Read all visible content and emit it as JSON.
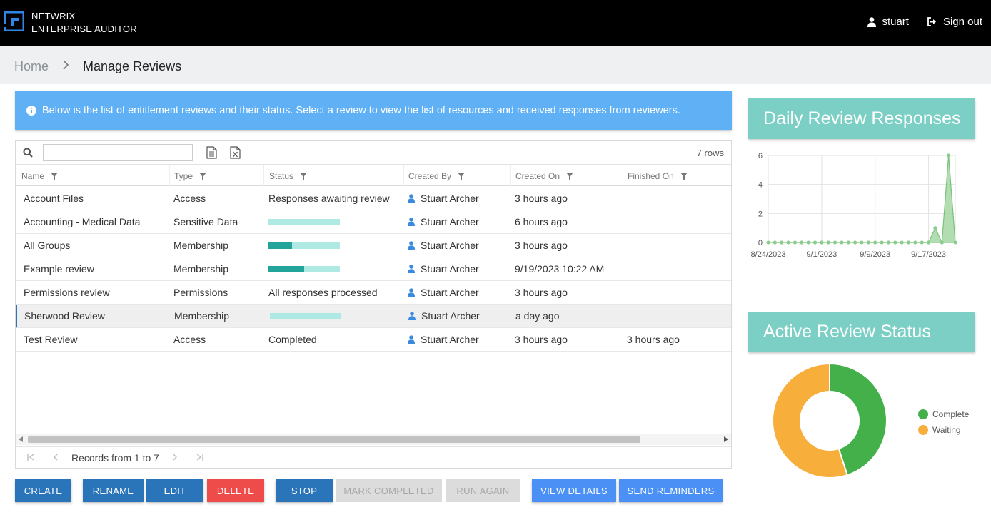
{
  "app": {
    "brand_line1": "NETWRIX",
    "brand_line2": "ENTERPRISE AUDITOR",
    "user": "stuart",
    "signout": "Sign out"
  },
  "breadcrumb": {
    "home": "Home",
    "current": "Manage Reviews"
  },
  "info": "Below is the list of entitlement reviews and their status. Select a review to view the list of resources and received responses from reviewers.",
  "grid": {
    "search_value": "",
    "row_count": "7 rows",
    "columns": [
      "Name",
      "Type",
      "Status",
      "Created By",
      "Created On",
      "Finished On"
    ],
    "rows": [
      {
        "name": "Account Files",
        "type": "Access",
        "status": "Responses awaiting review",
        "progress": null,
        "created_by": "Stuart Archer",
        "created_on": "3 hours ago",
        "finished_on": ""
      },
      {
        "name": "Accounting - Medical Data",
        "type": "Sensitive Data",
        "status": "",
        "progress": 0,
        "created_by": "Stuart Archer",
        "created_on": "6 hours ago",
        "finished_on": ""
      },
      {
        "name": "All Groups",
        "type": "Membership",
        "status": "",
        "progress": 0.33,
        "created_by": "Stuart Archer",
        "created_on": "3 hours ago",
        "finished_on": ""
      },
      {
        "name": "Example review",
        "type": "Membership",
        "status": "",
        "progress": 0.5,
        "created_by": "Stuart Archer",
        "created_on": "9/19/2023 10:22 AM",
        "finished_on": ""
      },
      {
        "name": "Permissions review",
        "type": "Permissions",
        "status": "All responses processed",
        "progress": null,
        "created_by": "Stuart Archer",
        "created_on": "3 hours ago",
        "finished_on": ""
      },
      {
        "name": "Sherwood Review",
        "type": "Membership",
        "status": "",
        "progress": 0,
        "created_by": "Stuart Archer",
        "created_on": "a day ago",
        "finished_on": ""
      },
      {
        "name": "Test Review",
        "type": "Access",
        "status": "Completed",
        "progress": null,
        "created_by": "Stuart Archer",
        "created_on": "3 hours ago",
        "finished_on": "3 hours ago"
      }
    ],
    "selected_row": 5,
    "pager_label": "Records from 1 to 7"
  },
  "buttons": {
    "create": "CREATE",
    "rename": "RENAME",
    "edit": "EDIT",
    "delete": "DELETE",
    "stop": "STOP",
    "mark_completed": "MARK COMPLETED",
    "run_again": "RUN AGAIN",
    "view_details": "VIEW DETAILS",
    "send_reminders": "SEND REMINDERS"
  },
  "panels": {
    "daily_title": "Daily Review Responses",
    "status_title": "Active Review Status"
  },
  "colors": {
    "accent": "#2a74b9",
    "info": "#5fb0f5",
    "panel": "#7bcfc4",
    "complete": "#43b04a",
    "waiting": "#f7ae3b"
  },
  "chart_data": [
    {
      "type": "area",
      "title": "Daily Review Responses",
      "x_tick_labels": [
        "8/24/2023",
        "9/1/2023",
        "9/9/2023",
        "9/17/2023"
      ],
      "y_tick_labels": [
        "0",
        "2",
        "4",
        "6"
      ],
      "ylim": [
        0,
        6
      ],
      "x": [
        "8/24/2023",
        "8/25/2023",
        "8/26/2023",
        "8/27/2023",
        "8/28/2023",
        "8/29/2023",
        "8/30/2023",
        "8/31/2023",
        "9/1/2023",
        "9/2/2023",
        "9/3/2023",
        "9/4/2023",
        "9/5/2023",
        "9/6/2023",
        "9/7/2023",
        "9/8/2023",
        "9/9/2023",
        "9/10/2023",
        "9/11/2023",
        "9/12/2023",
        "9/13/2023",
        "9/14/2023",
        "9/15/2023",
        "9/16/2023",
        "9/17/2023",
        "9/18/2023",
        "9/19/2023",
        "9/20/2023",
        "9/21/2023"
      ],
      "values": [
        0,
        0,
        0,
        0,
        0,
        0,
        0,
        0,
        0,
        0,
        0,
        0,
        0,
        0,
        0,
        0,
        0,
        0,
        0,
        0,
        0,
        0,
        0,
        0,
        0,
        1,
        0,
        6,
        0
      ],
      "grid": true
    },
    {
      "type": "pie",
      "title": "Active Review Status",
      "categories": [
        "Complete",
        "Waiting"
      ],
      "values": [
        0.45,
        0.55
      ],
      "donut": true,
      "legend": "right"
    }
  ]
}
